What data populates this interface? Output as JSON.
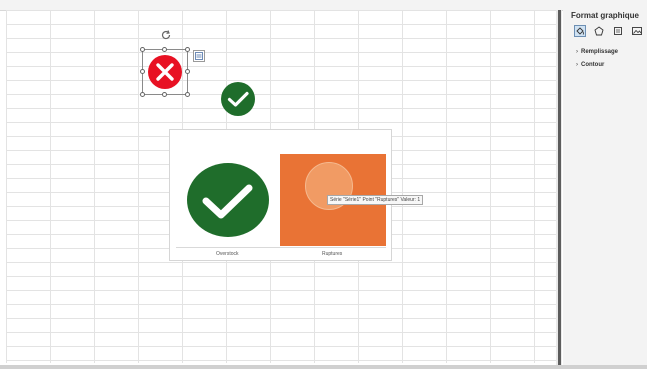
{
  "pane": {
    "title": "Format graphique",
    "icons": [
      "fill-line-icon",
      "effects-icon",
      "size-properties-icon",
      "picture-icon"
    ],
    "sections": [
      {
        "label": "Remplissage"
      },
      {
        "label": "Contour"
      }
    ]
  },
  "chart_data": {
    "type": "bar",
    "categories": [
      "Overstock",
      "Ruptures"
    ],
    "tooltip": "Série \"Série1\" Point \"Ruptures\" Valeur: 1"
  },
  "colors": {
    "red": "#e81123",
    "green": "#1f6d2b",
    "orange": "#e97335",
    "accent": "#2b579a"
  }
}
